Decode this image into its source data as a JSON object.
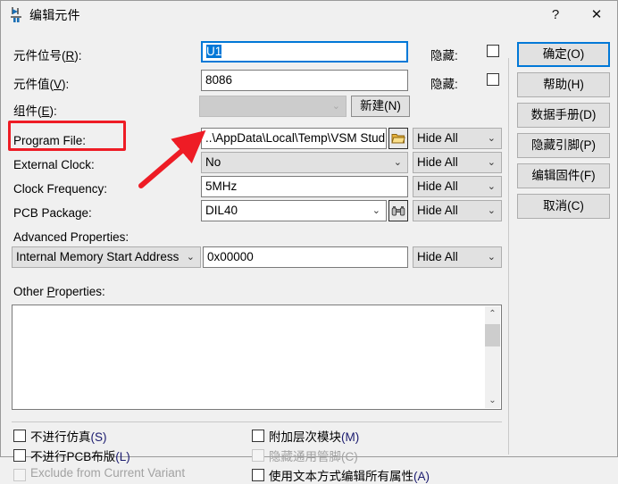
{
  "window": {
    "title": "编辑元件",
    "icon": "component-icon",
    "help_label": "?",
    "close_label": "✕"
  },
  "form": {
    "rows": [
      {
        "label": "元件位号(R):",
        "label_plain": "元件位号",
        "mnemonic": "R",
        "value": "U1",
        "hide_label": "隐藏:"
      },
      {
        "label": "元件值(V):",
        "label_plain": "元件值",
        "mnemonic": "V",
        "value": "8086",
        "hide_label": "隐藏:"
      },
      {
        "label": "组件(E):",
        "label_plain": "组件",
        "mnemonic": "E",
        "value": "",
        "new_button": "新建(N)"
      }
    ],
    "program_file": {
      "label": "Program File:",
      "value": "..\\AppData\\Local\\Temp\\VSM Stud",
      "browse_icon": "folder-open-icon",
      "hide": "Hide All"
    },
    "external_clock": {
      "label": "External Clock:",
      "value": "No",
      "hide": "Hide All"
    },
    "clock_frequency": {
      "label": "Clock Frequency:",
      "value": "5MHz",
      "hide": "Hide All"
    },
    "pcb_package": {
      "label": "PCB Package:",
      "value": "DIL40",
      "search_icon": "binoculars-icon",
      "hide": "Hide All"
    },
    "advanced_properties": {
      "label": "Advanced Properties:",
      "selected": "Internal Memory Start Address",
      "value": "0x00000",
      "hide": "Hide All"
    },
    "other_properties": {
      "label": "Other Properties:",
      "label_plain_pre": "Other ",
      "mnemonic": "P",
      "label_plain_post": "roperties:",
      "value": ""
    }
  },
  "checkboxes": {
    "left": [
      {
        "label_pre": "不进行仿真",
        "mnemonic": "(S)",
        "checked": false,
        "disabled": false
      },
      {
        "label_pre": "不进行PCB布版",
        "mnemonic": "(L)",
        "checked": false,
        "disabled": false
      },
      {
        "label_pre": "Exclude from Current Variant",
        "mnemonic": "",
        "checked": false,
        "disabled": true
      }
    ],
    "right": [
      {
        "label_pre": "附加层次模块",
        "mnemonic": "(M)",
        "checked": false,
        "disabled": false
      },
      {
        "label_pre": "隐藏通用管脚",
        "mnemonic": "(C)",
        "checked": false,
        "disabled": true
      },
      {
        "label_pre": "使用文本方式编辑所有属性",
        "mnemonic": "(A)",
        "checked": false,
        "disabled": false
      }
    ]
  },
  "buttons": [
    {
      "label": "确定(O)",
      "primary": true
    },
    {
      "label": "帮助(H)",
      "primary": false
    },
    {
      "label": "数据手册(D)",
      "primary": false
    },
    {
      "label": "隐藏引脚(P)",
      "primary": false
    },
    {
      "label": "编辑固件(F)",
      "primary": false
    },
    {
      "label": "取消(C)",
      "primary": false
    }
  ],
  "annotation": {
    "highlight_target": "Program File:",
    "box_color": "#ee1c25",
    "arrow_color": "#ee1c25"
  }
}
